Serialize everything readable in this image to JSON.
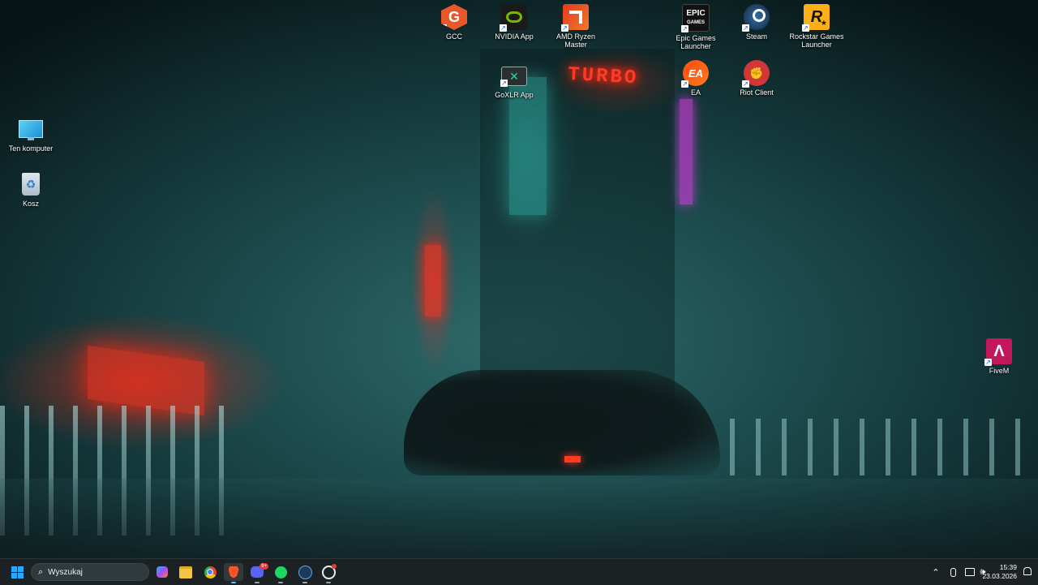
{
  "desktop": {
    "left_icons": [
      {
        "label": "Ten komputer",
        "icon": "monitor-icon"
      },
      {
        "label": "Kosz",
        "icon": "recycle-bin-icon"
      }
    ],
    "top_icons": [
      {
        "label": "GCC",
        "icon": "gcc-icon",
        "color": "#e8582a"
      },
      {
        "label": "NVIDIA App",
        "icon": "nvidia-icon",
        "color": "#76b900"
      },
      {
        "label": "AMD Ryzen Master",
        "icon": "amd-ryzen-icon",
        "color": "#e23a1f"
      },
      {
        "label": "Epic Games Launcher",
        "icon": "epic-games-icon",
        "color": "#111111"
      },
      {
        "label": "Steam",
        "icon": "steam-icon",
        "color": "#1b2838"
      },
      {
        "label": "Rockstar Games Launcher",
        "icon": "rockstar-icon",
        "color": "#fcaf17"
      },
      {
        "label": "GoXLR App",
        "icon": "goxlr-icon",
        "color": "#2b2f30"
      },
      {
        "label": "EA",
        "icon": "ea-icon",
        "color": "#ff4a11"
      },
      {
        "label": "Riot Client",
        "icon": "riot-icon",
        "color": "#d13639"
      }
    ],
    "right_icons": [
      {
        "label": "FiveM",
        "icon": "fivem-icon",
        "color": "#c2185b"
      }
    ],
    "wallpaper_signs": {
      "turbo": "TURBO"
    }
  },
  "taskbar": {
    "search_placeholder": "Wyszukaj",
    "apps": [
      "start-icon",
      "copilot-icon",
      "file-explorer-icon",
      "chrome-icon",
      "brave-icon",
      "discord-icon",
      "spotify-icon",
      "steam-taskbar-icon",
      "chatgpt-icon"
    ],
    "discord_badge": "9+",
    "time": "15:39",
    "date": "23.03.2026",
    "accent": "#1a8cff"
  }
}
